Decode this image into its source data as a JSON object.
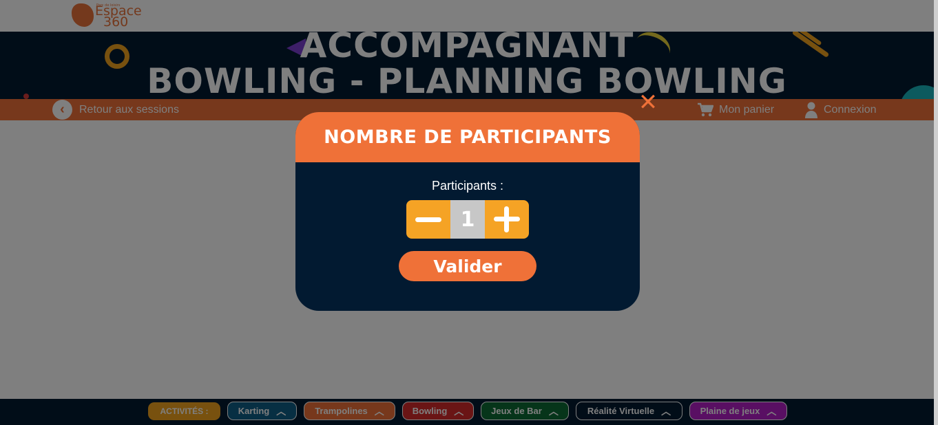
{
  "logo": {
    "tagline": "Parc de loisirs",
    "line1": "Espace",
    "line2": "360"
  },
  "banner": {
    "title_line1": "ACCOMPAGNANT",
    "title_line2": "BOWLING - PLANNING BOWLING"
  },
  "nav": {
    "back_label": "Retour aux sessions",
    "cart_label": "Mon panier",
    "login_label": "Connexion"
  },
  "modal": {
    "title": "NOMBRE DE PARTICIPANTS",
    "field_label": "Participants :",
    "participants_value": "1",
    "validate_label": "Valider",
    "close_symbol": "✕"
  },
  "footer": {
    "label": "ACTIVITÉS :",
    "activities": [
      {
        "label": "Karting",
        "color": "#0f5f86"
      },
      {
        "label": "Trampolines",
        "color": "#ef7138"
      },
      {
        "label": "Bowling",
        "color": "#d52a2a"
      },
      {
        "label": "Jeux de Bar",
        "color": "#0d6b35"
      },
      {
        "label": "Réalité Virtuelle",
        "color": "#021a31"
      },
      {
        "label": "Plaine de jeux",
        "color": "#b21ec6"
      }
    ]
  },
  "colors": {
    "accent_orange": "#ef7138",
    "navy": "#021a31",
    "stepper_yellow": "#f5a325"
  },
  "icons": {
    "back": "chevron-left-icon",
    "cart": "cart-icon",
    "user": "user-icon",
    "close": "close-icon",
    "minus": "minus-icon",
    "plus": "plus-icon",
    "chevron": "chevron-up-icon"
  }
}
